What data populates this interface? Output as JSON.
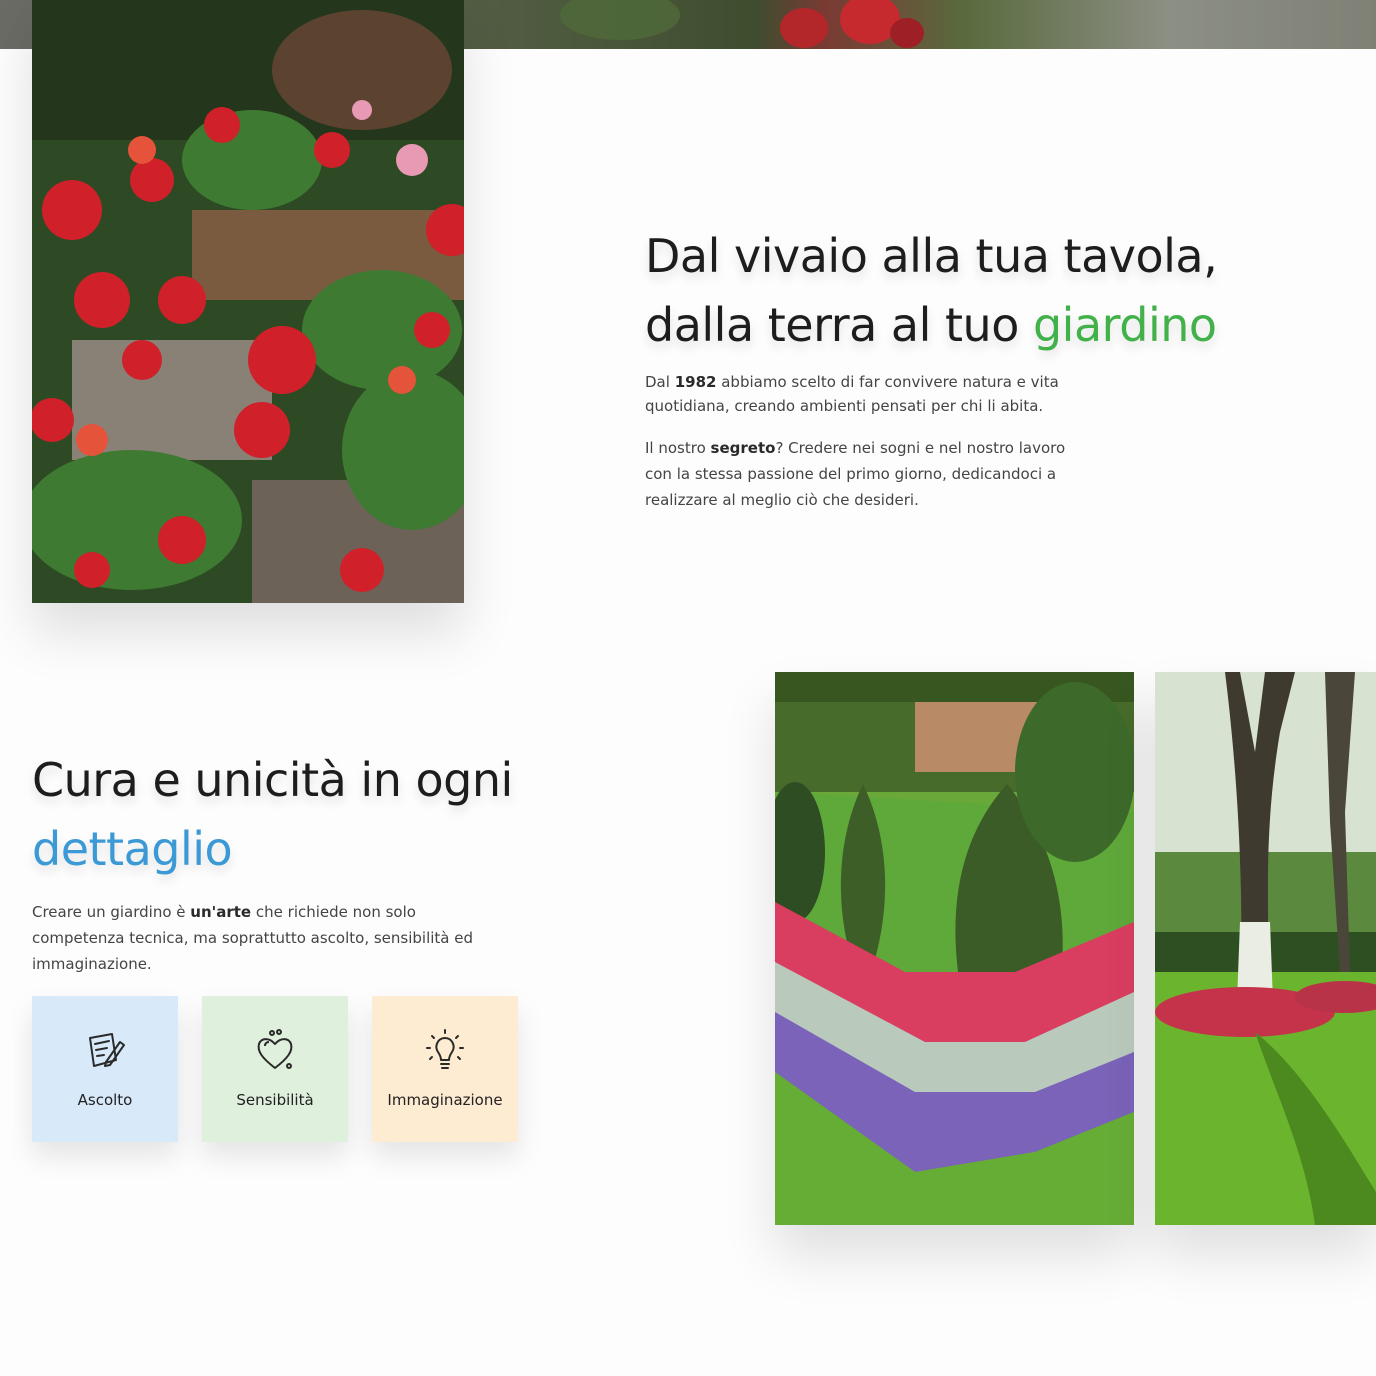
{
  "intro": {
    "title_line1": "Dal vivaio alla tua tavola,",
    "title_line2": "dalla terra al tuo",
    "title_accent": "giardino",
    "p1_before": "Dal",
    "p1_strong": "1982",
    "p1_after": "abbiamo scelto di far convivere natura e vita quotidiana, creando ambienti pensati per chi li abita.",
    "p2_before": "Il nostro",
    "p2_strong": "segreto",
    "p2_after": "? Credere nei sogni e nel nostro lavoro con la stessa passione del primo giorno, dedicandoci a realizzare al meglio ciò che desideri.",
    "accent_color": "#43b14a"
  },
  "care": {
    "title_line1": "Cura e unicità in ogni",
    "title_accent": "dettaglio",
    "p_before": "Creare un giardino è",
    "p_strong": "un'arte",
    "p_after": "che richiede non solo competenza tecnica, ma soprattutto ascolto, sensibilità ed immaginazione.",
    "accent_color": "#3b99d6",
    "cards": [
      {
        "label": "Ascolto",
        "icon": "notepad-pencil-icon",
        "color": "#d8e9f9"
      },
      {
        "label": "Sensibilità",
        "icon": "heart-icon",
        "color": "#dff0dc"
      },
      {
        "label": "Immaginazione",
        "icon": "lightbulb-icon",
        "color": "#fdebd2"
      }
    ]
  }
}
